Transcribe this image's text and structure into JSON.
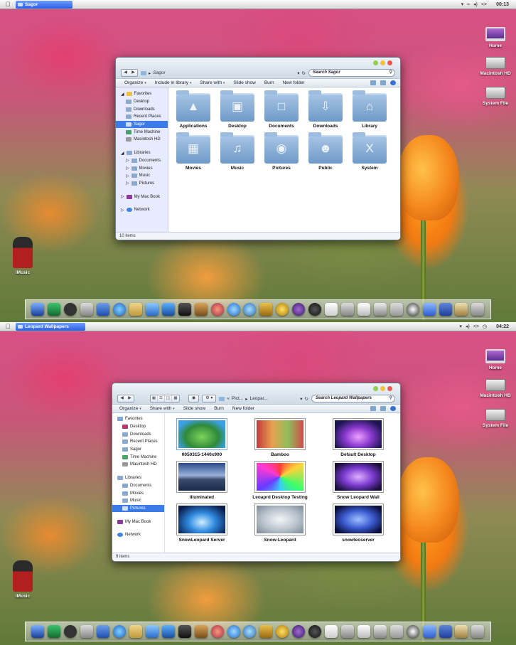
{
  "top": {
    "menubar": {
      "window_tab": "Sagor",
      "clock": "00:13"
    },
    "desktop_icons": {
      "home": "Home",
      "macintosh_hd": "Macintosh HD",
      "system_file": "System File",
      "imusic": "iMusic"
    },
    "window": {
      "path": "Sagor",
      "search_placeholder": "Search Sagor",
      "toolbar": {
        "organize": "Organize",
        "include_in_library": "Include in library",
        "share_with": "Share with",
        "slide_show": "Slide show",
        "burn": "Burn",
        "new_folder": "New folder"
      },
      "sidebar": {
        "favorites": "Favorites",
        "fav_items": [
          "Desktop",
          "Downloads",
          "Recent Places",
          "Sagor",
          "Time Machine",
          "Macintosh HD"
        ],
        "libraries": "Libraries",
        "lib_items": [
          "Documents",
          "Movies",
          "Music",
          "Pictures"
        ],
        "my_mac_book": "My Mac Book",
        "network": "Network"
      },
      "folders": [
        "Applications",
        "Desktop",
        "Documents",
        "Downloads",
        "Library",
        "Movies",
        "Music",
        "Pictures",
        "Public",
        "System"
      ],
      "status": "10 items"
    }
  },
  "bottom": {
    "menubar": {
      "window_tab": "Leopard Wallpapers",
      "clock": "04:22"
    },
    "desktop_icons": {
      "home": "Home",
      "macintosh_hd": "Macintosh HD",
      "system_file": "System File",
      "imusic": "iMusic"
    },
    "window": {
      "breadcrumb": [
        "Pict...",
        "Leopar..."
      ],
      "search_placeholder": "Search Leopard Wallpapers",
      "toolbar": {
        "organize": "Organize",
        "share_with": "Share with",
        "slide_show": "Slide show",
        "burn": "Burn",
        "new_folder": "New folder"
      },
      "sidebar": {
        "favorites": "Favorites",
        "fav_items": [
          "Desktop",
          "Downloads",
          "Recent Places",
          "Sagor",
          "Time Machine",
          "Macintosh HD"
        ],
        "libraries": "Libraries",
        "lib_items": [
          "Documents",
          "Movies",
          "Music",
          "Pictures"
        ],
        "my_mac_book": "My Mac Book",
        "network": "Network"
      },
      "files": [
        "0050315-1440x900",
        "Bamboo",
        "Default Desktop",
        "Illuminated",
        "Leoaprd Desktop Testing",
        "Snow Leopard Wall",
        "SnowLeopard Server",
        "Snow-Leopard",
        "snowleoserver"
      ],
      "status": "9 items"
    }
  },
  "colors": {
    "selection": "#3b7be8",
    "sidebar_bg": "#e8ebff",
    "folder_blue": "#7fa6d3",
    "title_tab": "#2b5fe6"
  }
}
